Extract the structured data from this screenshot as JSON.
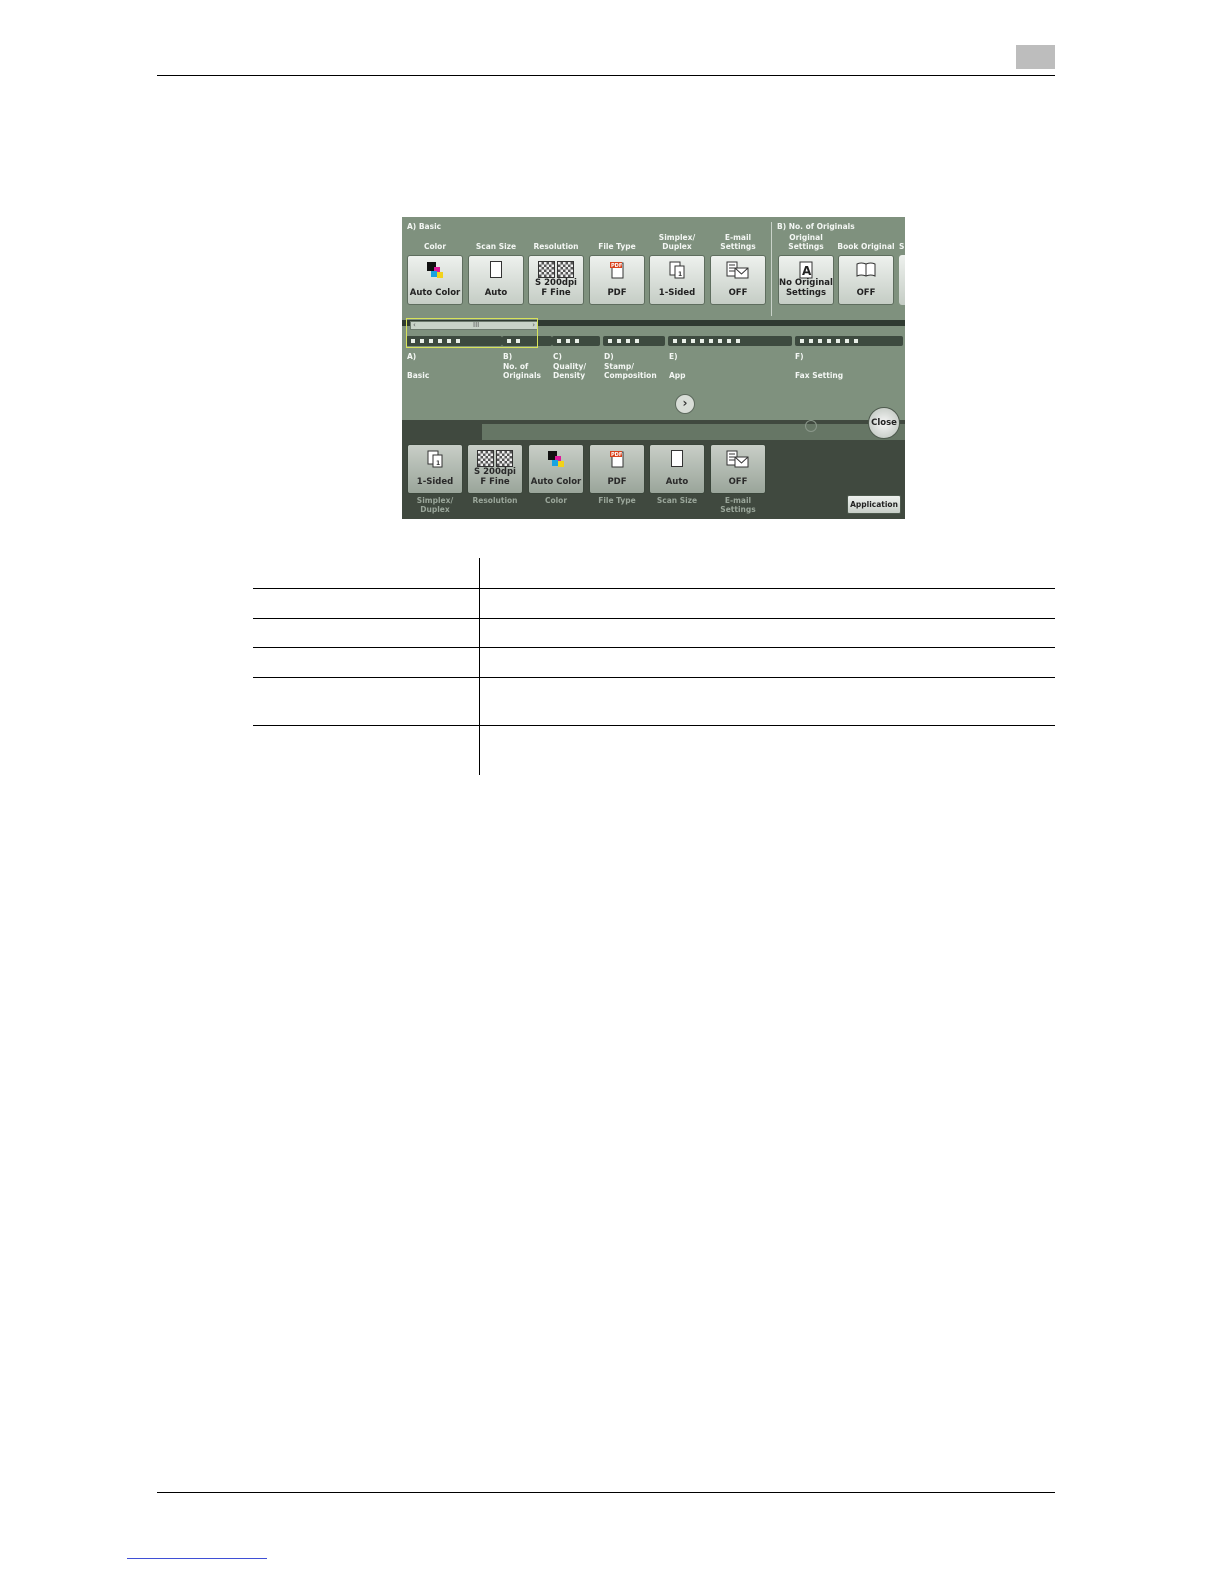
{
  "panel": {
    "groupA": "A)   Basic",
    "groupB": "B)   No. of Originals",
    "top_buttons": [
      {
        "caption": "Color",
        "label": "Auto Color",
        "icon": "color-icon"
      },
      {
        "caption": "Scan Size",
        "label": "Auto",
        "icon": "page-icon"
      },
      {
        "caption": "Resolution",
        "label": "S 200dpi\nF Fine",
        "icon": "resolution-icon"
      },
      {
        "caption": "File Type",
        "label": "PDF",
        "icon": "pdf-icon"
      },
      {
        "caption": "Simplex/\nDuplex",
        "label": "1-Sided",
        "icon": "simplex-icon"
      },
      {
        "caption": "E-mail\nSettings",
        "label": "OFF",
        "icon": "email-icon"
      },
      {
        "caption": "Original\nSettings",
        "label": "No Original\nSettings",
        "icon": "original-icon"
      },
      {
        "caption": "Book Original",
        "label": "OFF",
        "icon": "book-icon"
      }
    ],
    "partial_caption": "S",
    "scroll_glyph": "III",
    "sections": [
      {
        "code": "A)",
        "name": "Basic"
      },
      {
        "code": "B)",
        "name": "No. of\nOriginals"
      },
      {
        "code": "C)",
        "name": "Quality/\nDensity"
      },
      {
        "code": "D)",
        "name": "Stamp/\nComposition"
      },
      {
        "code": "E)",
        "name": "App"
      },
      {
        "code": "F)",
        "name": "Fax Setting"
      }
    ],
    "next_glyph": "›",
    "close_label": "Close",
    "bottom_buttons": [
      {
        "caption": "Simplex/\nDuplex",
        "label": "1-Sided",
        "icon": "simplex-icon"
      },
      {
        "caption": "Resolution",
        "label": "S 200dpi\nF Fine",
        "icon": "resolution-icon"
      },
      {
        "caption": "Color",
        "label": "Auto Color",
        "icon": "color-icon"
      },
      {
        "caption": "File Type",
        "label": "PDF",
        "icon": "pdf-icon"
      },
      {
        "caption": "Scan Size",
        "label": "Auto",
        "icon": "page-icon"
      },
      {
        "caption": "E-mail\nSettings",
        "label": "OFF",
        "icon": "email-icon"
      }
    ],
    "application_label": "Application"
  }
}
